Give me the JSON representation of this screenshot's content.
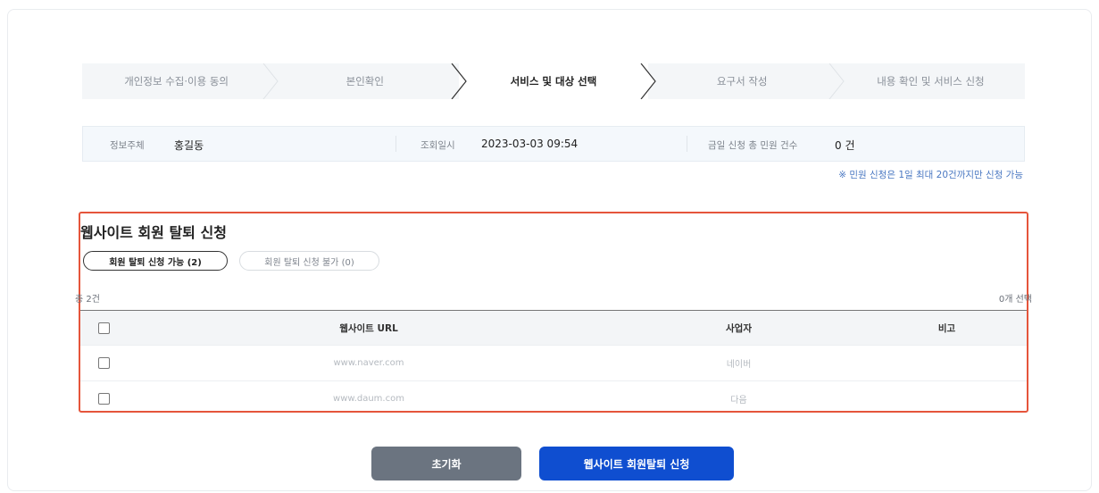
{
  "steps": [
    "개인정보 수집·이용 동의",
    "본인확인",
    "서비스 및 대상 선택",
    "요구서 작성",
    "내용 확인 및 서비스 신청"
  ],
  "info": {
    "subject_label": "정보주체",
    "subject_value": "홍길동",
    "time_label": "조회일시",
    "time_value": "2023-03-03 09:54",
    "count_label": "금일 신청 총 민원 건수",
    "count_value": "0 건"
  },
  "notice": "※ 민원 신청은 1일 최대 20건까지만 신청 가능",
  "panel": {
    "title": "웹사이트 회원 탈퇴 신청",
    "tab_available": "회원 탈퇴 신청 가능 (2)",
    "tab_unavailable": "회원 탈퇴 신청 불가 (0)",
    "total": "총 2건",
    "selected": "0개 선택",
    "headers": {
      "url": "웹사이트 URL",
      "company": "사업자",
      "note": "비고"
    },
    "rows": [
      {
        "url": "www.naver.com",
        "company": "네이버",
        "note": ""
      },
      {
        "url": "www.daum.com",
        "company": "다음",
        "note": ""
      }
    ]
  },
  "buttons": {
    "reset": "초기화",
    "apply": "웹사이트 회원탈퇴 신청"
  },
  "colors": {
    "accent": "#0f4ed0",
    "highlight_border": "#e5553b"
  }
}
